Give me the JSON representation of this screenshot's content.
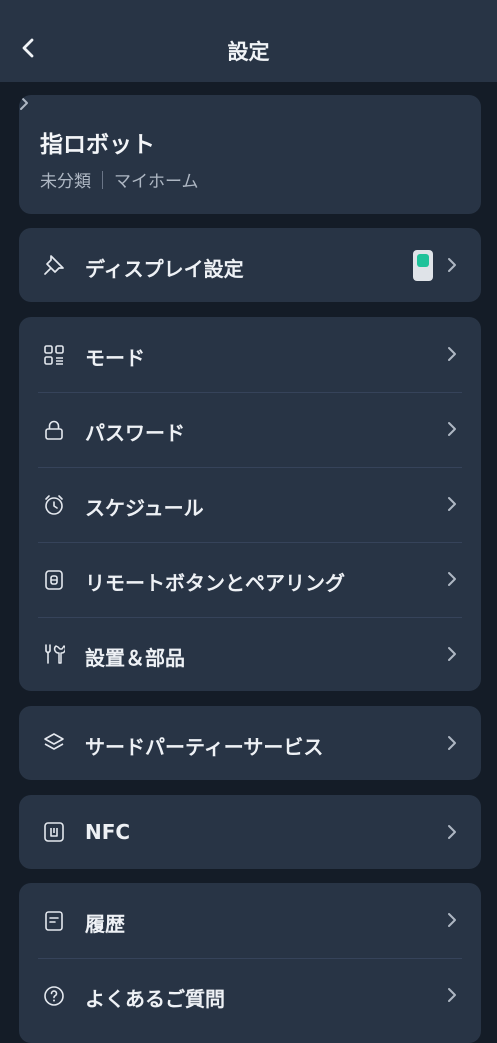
{
  "header": {
    "title": "設定"
  },
  "device": {
    "name": "指ロボット",
    "category": "未分類",
    "home": "マイホーム"
  },
  "display_row": {
    "label": "ディスプレイ設定",
    "accent_color": "#1fc29a"
  },
  "group_main": [
    {
      "label": "モード",
      "icon": "grid-list-icon"
    },
    {
      "label": "パスワード",
      "icon": "lock-icon"
    },
    {
      "label": "スケジュール",
      "icon": "alarm-clock-icon"
    },
    {
      "label": "リモートボタンとペアリング",
      "icon": "remote-button-icon"
    },
    {
      "label": "設置＆部品",
      "icon": "tools-icon"
    }
  ],
  "third_party": {
    "label": "サードパーティーサービス",
    "icon": "layers-icon"
  },
  "nfc": {
    "label": "NFC",
    "icon": "nfc-icon"
  },
  "group_bottom": [
    {
      "label": "履歴",
      "icon": "document-icon"
    },
    {
      "label": "よくあるご質問",
      "icon": "help-circle-icon"
    }
  ]
}
